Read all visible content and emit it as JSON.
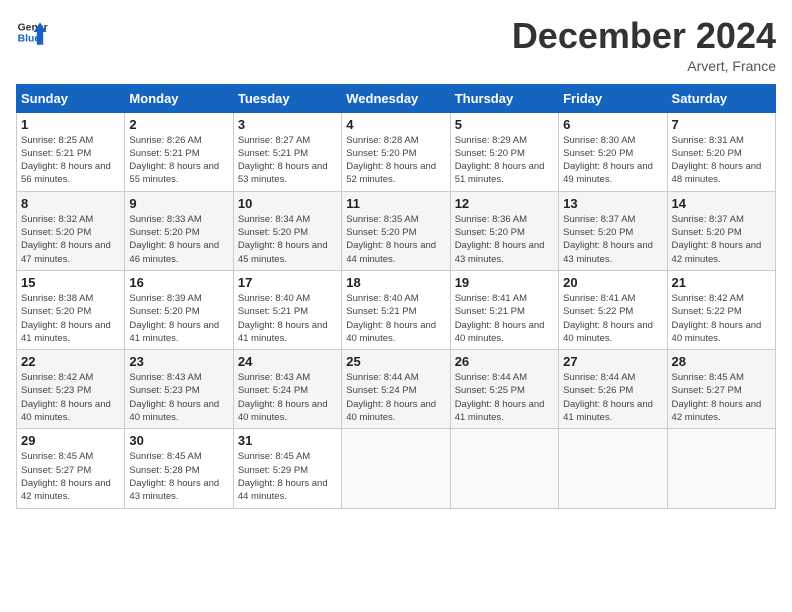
{
  "header": {
    "logo_line1": "General",
    "logo_line2": "Blue",
    "month": "December 2024",
    "location": "Arvert, France"
  },
  "days_of_week": [
    "Sunday",
    "Monday",
    "Tuesday",
    "Wednesday",
    "Thursday",
    "Friday",
    "Saturday"
  ],
  "weeks": [
    [
      {
        "day": 1,
        "sunrise": "8:25 AM",
        "sunset": "5:21 PM",
        "daylight": "8 hours and 56 minutes."
      },
      {
        "day": 2,
        "sunrise": "8:26 AM",
        "sunset": "5:21 PM",
        "daylight": "8 hours and 55 minutes."
      },
      {
        "day": 3,
        "sunrise": "8:27 AM",
        "sunset": "5:21 PM",
        "daylight": "8 hours and 53 minutes."
      },
      {
        "day": 4,
        "sunrise": "8:28 AM",
        "sunset": "5:20 PM",
        "daylight": "8 hours and 52 minutes."
      },
      {
        "day": 5,
        "sunrise": "8:29 AM",
        "sunset": "5:20 PM",
        "daylight": "8 hours and 51 minutes."
      },
      {
        "day": 6,
        "sunrise": "8:30 AM",
        "sunset": "5:20 PM",
        "daylight": "8 hours and 49 minutes."
      },
      {
        "day": 7,
        "sunrise": "8:31 AM",
        "sunset": "5:20 PM",
        "daylight": "8 hours and 48 minutes."
      }
    ],
    [
      {
        "day": 8,
        "sunrise": "8:32 AM",
        "sunset": "5:20 PM",
        "daylight": "8 hours and 47 minutes."
      },
      {
        "day": 9,
        "sunrise": "8:33 AM",
        "sunset": "5:20 PM",
        "daylight": "8 hours and 46 minutes."
      },
      {
        "day": 10,
        "sunrise": "8:34 AM",
        "sunset": "5:20 PM",
        "daylight": "8 hours and 45 minutes."
      },
      {
        "day": 11,
        "sunrise": "8:35 AM",
        "sunset": "5:20 PM",
        "daylight": "8 hours and 44 minutes."
      },
      {
        "day": 12,
        "sunrise": "8:36 AM",
        "sunset": "5:20 PM",
        "daylight": "8 hours and 43 minutes."
      },
      {
        "day": 13,
        "sunrise": "8:37 AM",
        "sunset": "5:20 PM",
        "daylight": "8 hours and 43 minutes."
      },
      {
        "day": 14,
        "sunrise": "8:37 AM",
        "sunset": "5:20 PM",
        "daylight": "8 hours and 42 minutes."
      }
    ],
    [
      {
        "day": 15,
        "sunrise": "8:38 AM",
        "sunset": "5:20 PM",
        "daylight": "8 hours and 41 minutes."
      },
      {
        "day": 16,
        "sunrise": "8:39 AM",
        "sunset": "5:20 PM",
        "daylight": "8 hours and 41 minutes."
      },
      {
        "day": 17,
        "sunrise": "8:40 AM",
        "sunset": "5:21 PM",
        "daylight": "8 hours and 41 minutes."
      },
      {
        "day": 18,
        "sunrise": "8:40 AM",
        "sunset": "5:21 PM",
        "daylight": "8 hours and 40 minutes."
      },
      {
        "day": 19,
        "sunrise": "8:41 AM",
        "sunset": "5:21 PM",
        "daylight": "8 hours and 40 minutes."
      },
      {
        "day": 20,
        "sunrise": "8:41 AM",
        "sunset": "5:22 PM",
        "daylight": "8 hours and 40 minutes."
      },
      {
        "day": 21,
        "sunrise": "8:42 AM",
        "sunset": "5:22 PM",
        "daylight": "8 hours and 40 minutes."
      }
    ],
    [
      {
        "day": 22,
        "sunrise": "8:42 AM",
        "sunset": "5:23 PM",
        "daylight": "8 hours and 40 minutes."
      },
      {
        "day": 23,
        "sunrise": "8:43 AM",
        "sunset": "5:23 PM",
        "daylight": "8 hours and 40 minutes."
      },
      {
        "day": 24,
        "sunrise": "8:43 AM",
        "sunset": "5:24 PM",
        "daylight": "8 hours and 40 minutes."
      },
      {
        "day": 25,
        "sunrise": "8:44 AM",
        "sunset": "5:24 PM",
        "daylight": "8 hours and 40 minutes."
      },
      {
        "day": 26,
        "sunrise": "8:44 AM",
        "sunset": "5:25 PM",
        "daylight": "8 hours and 41 minutes."
      },
      {
        "day": 27,
        "sunrise": "8:44 AM",
        "sunset": "5:26 PM",
        "daylight": "8 hours and 41 minutes."
      },
      {
        "day": 28,
        "sunrise": "8:45 AM",
        "sunset": "5:27 PM",
        "daylight": "8 hours and 42 minutes."
      }
    ],
    [
      {
        "day": 29,
        "sunrise": "8:45 AM",
        "sunset": "5:27 PM",
        "daylight": "8 hours and 42 minutes."
      },
      {
        "day": 30,
        "sunrise": "8:45 AM",
        "sunset": "5:28 PM",
        "daylight": "8 hours and 43 minutes."
      },
      {
        "day": 31,
        "sunrise": "8:45 AM",
        "sunset": "5:29 PM",
        "daylight": "8 hours and 44 minutes."
      },
      null,
      null,
      null,
      null
    ]
  ]
}
